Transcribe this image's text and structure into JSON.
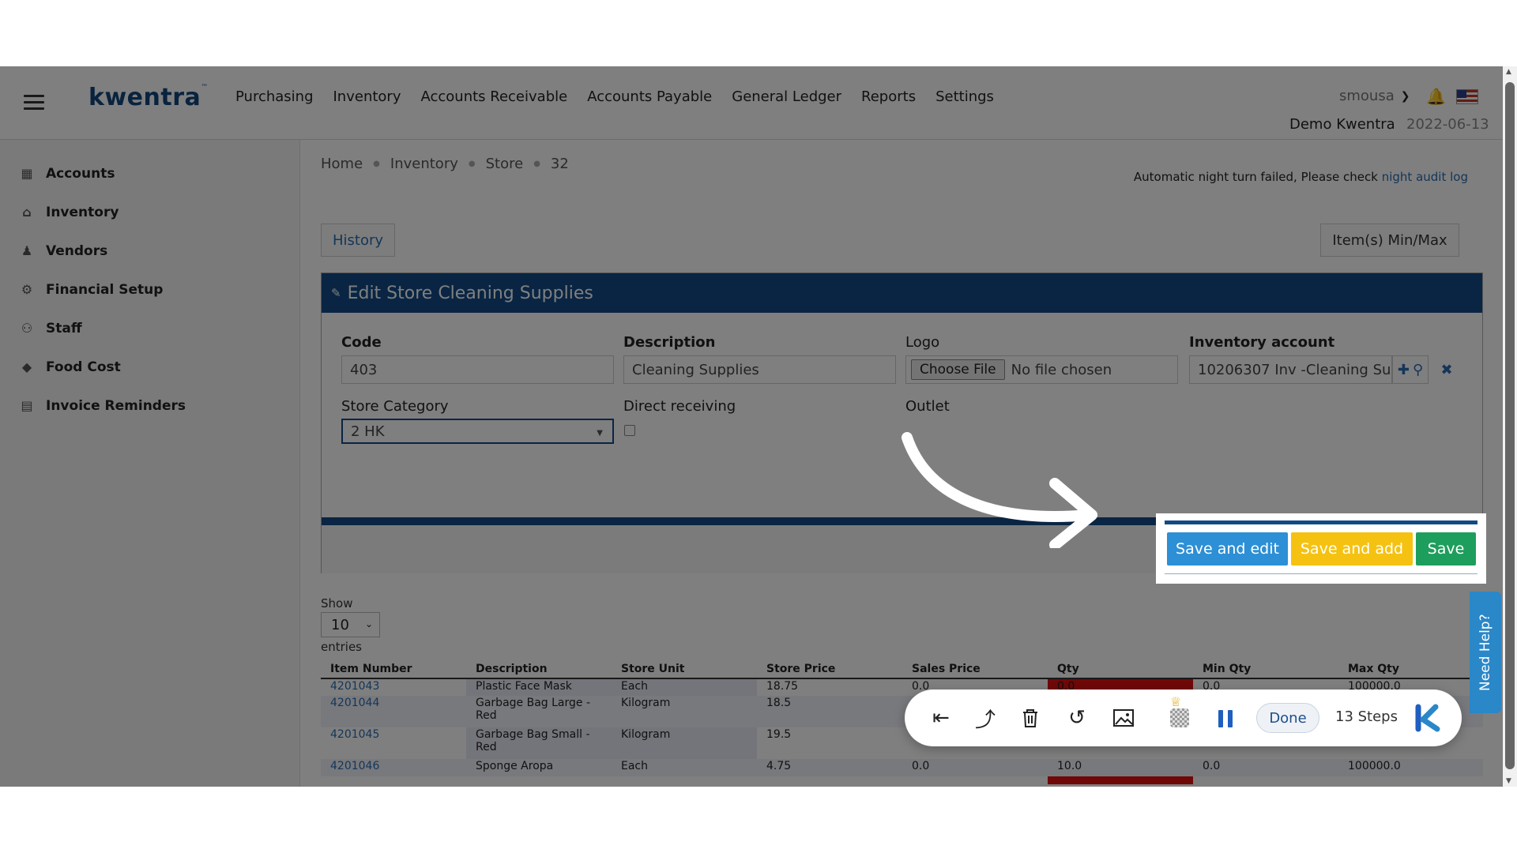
{
  "header": {
    "brand": "kwentra",
    "trademark": "™",
    "nav": [
      "Purchasing",
      "Inventory",
      "Accounts Receivable",
      "Accounts Payable",
      "General Ledger",
      "Reports",
      "Settings"
    ],
    "username": "smousa",
    "company": "Demo Kwentra",
    "date": "2022-06-13"
  },
  "sidebar": {
    "items": [
      {
        "label": "Accounts",
        "icon": "calculator-icon"
      },
      {
        "label": "Inventory",
        "icon": "warehouse-icon"
      },
      {
        "label": "Vendors",
        "icon": "person-icon"
      },
      {
        "label": "Financial Setup",
        "icon": "coin-gear-icon"
      },
      {
        "label": "Staff",
        "icon": "users-icon"
      },
      {
        "label": "Food Cost",
        "icon": "tag-icon"
      },
      {
        "label": "Invoice Reminders",
        "icon": "document-icon"
      }
    ]
  },
  "breadcrumb": [
    "Home",
    "Inventory",
    "Store",
    "32"
  ],
  "notice": {
    "text": "Automatic night turn failed, Please check",
    "link": "night audit log"
  },
  "buttons": {
    "history": "History",
    "minmax": "Item(s) Min/Max"
  },
  "panel": {
    "title": "Edit Store Cleaning Supplies",
    "code_label": "Code",
    "code_value": "403",
    "description_label": "Description",
    "description_value": "Cleaning Supplies",
    "logo_label": "Logo",
    "choose_file": "Choose File",
    "no_file": "No file chosen",
    "inventory_account_label": "Inventory account",
    "inventory_account_value": "10206307 Inv -Cleaning Su",
    "store_category_label": "Store Category",
    "store_category_value": "2 HK",
    "direct_receiving_label": "Direct receiving",
    "direct_receiving_checked": false,
    "outlet_label": "Outlet"
  },
  "actions": {
    "save_and_edit": "Save and edit",
    "save_and_add": "Save and add",
    "save": "Save",
    "colors": {
      "save_and_edit": "#2d8fd5",
      "save_and_add": "#f5c211",
      "save": "#1e9e5c"
    }
  },
  "table": {
    "show_label": "Show",
    "show_value": "10",
    "entries_label": "entries",
    "headers": [
      "Item Number",
      "Description",
      "Store Unit",
      "Store Price",
      "Sales Price",
      "Qty",
      "Min Qty",
      "Max Qty"
    ],
    "rows": [
      [
        "4201043",
        "Plastic Face Mask",
        "Each",
        "18.75",
        "0.0",
        "0.0",
        "0.0",
        "100000.0"
      ],
      [
        "4201044",
        "Garbage Bag Large - Red",
        "Kilogram",
        "18.5",
        "",
        "",
        "",
        ""
      ],
      [
        "4201045",
        "Garbage Bag Small - Red",
        "Kilogram",
        "19.5",
        "",
        "",
        "",
        ""
      ],
      [
        "4201046",
        "Sponge Aropa",
        "Each",
        "4.75",
        "0.0",
        "10.0",
        "0.0",
        "100000.0"
      ]
    ]
  },
  "need_help": "Need Help?",
  "recorder": {
    "done": "Done",
    "steps": "13 Steps",
    "icons": [
      "rewind-to-start-icon",
      "share-up-icon",
      "trash-icon",
      "undo-icon",
      "image-icon",
      "blur-icon",
      "pause-icon",
      "kwentra-k-logo-icon"
    ]
  }
}
